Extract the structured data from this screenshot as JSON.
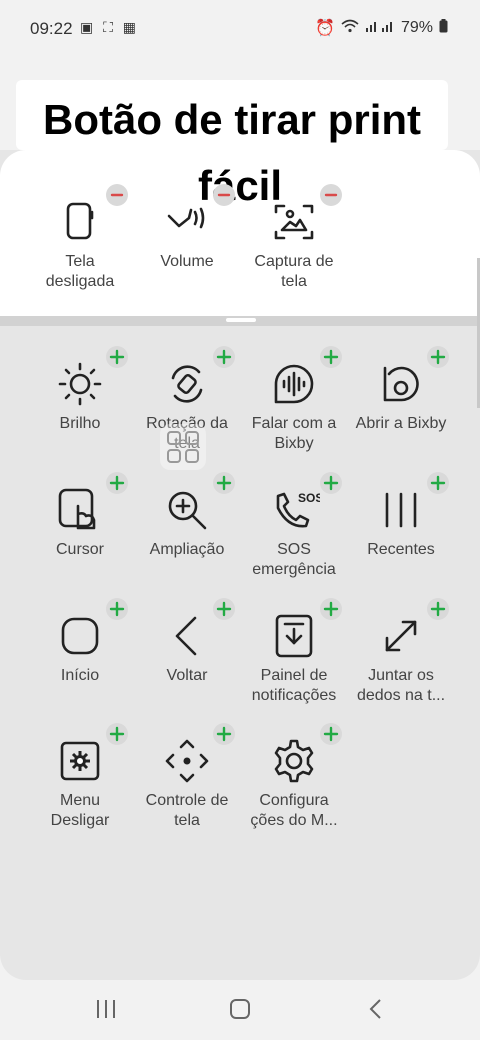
{
  "status": {
    "time": "09:22",
    "battery": "79%"
  },
  "caption": {
    "line1": "Botão de tirar print",
    "line2": "fácil"
  },
  "active_buttons": [
    {
      "label": "Tela\ndesligada",
      "icon": "phone-side-icon"
    },
    {
      "label": "Volume",
      "icon": "volume-hand-icon"
    },
    {
      "label": "Captura de\ntela",
      "icon": "screenshot-icon"
    }
  ],
  "available_buttons": [
    {
      "label": "Brilho",
      "icon": "sun-icon"
    },
    {
      "label": "Rotação da\ntela",
      "icon": "rotate-icon"
    },
    {
      "label": "Falar com a\nBixby",
      "icon": "voice-icon"
    },
    {
      "label": "Abrir a Bixby",
      "icon": "bixby-icon"
    },
    {
      "label": "Cursor",
      "icon": "cursor-icon"
    },
    {
      "label": "Ampliação",
      "icon": "zoom-icon"
    },
    {
      "label": "SOS\nemergência",
      "icon": "sos-icon"
    },
    {
      "label": "Recentes",
      "icon": "recents-icon"
    },
    {
      "label": "Início",
      "icon": "home-icon"
    },
    {
      "label": "Voltar",
      "icon": "back-icon"
    },
    {
      "label": "Painel de\nnotificações",
      "icon": "notification-panel-icon"
    },
    {
      "label": "Juntar os\ndedos na t...",
      "icon": "pinch-icon"
    },
    {
      "label": "Menu\nDesligar",
      "icon": "power-menu-icon"
    },
    {
      "label": "Controle de\ntela",
      "icon": "screen-control-icon"
    },
    {
      "label": "Configura\nções do M...",
      "icon": "settings-icon"
    }
  ],
  "colors": {
    "remove_badge": "#d94a4a",
    "add_badge": "#22aa44"
  }
}
